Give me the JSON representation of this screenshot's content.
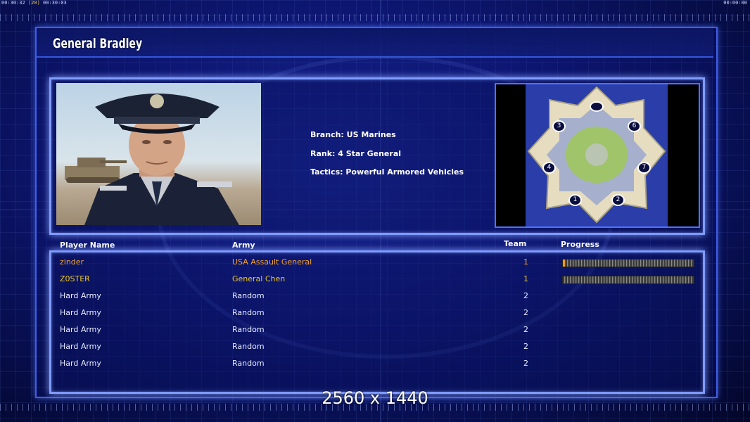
{
  "hud": {
    "time_left_prefix": "00:30:32",
    "time_left_mid": "(20)",
    "time_left_suffix": "00:30:03",
    "time_right": "00:00:00"
  },
  "general": {
    "name": "General Bradley",
    "branch": "Branch: US Marines",
    "rank": "Rank: 4 Star General",
    "tactics": "Tactics: Powerful Armored Vehicles"
  },
  "minimap": {
    "slots": [
      "1",
      "2",
      "3",
      "4",
      "6",
      "7"
    ]
  },
  "table": {
    "headers": {
      "name": "Player Name",
      "army": "Army",
      "team": "Team",
      "progress": "Progress"
    },
    "rows": [
      {
        "name": "zinder",
        "army": "USA Assault General",
        "team": "1",
        "progress": 0.01,
        "color": "#f2a129"
      },
      {
        "name": "Z0STER",
        "army": "General Chen",
        "team": "1",
        "progress": 0.0,
        "color": "#e9c626"
      },
      {
        "name": "Hard Army",
        "army": "Random",
        "team": "2",
        "color": "#e8ecff"
      },
      {
        "name": "Hard Army",
        "army": "Random",
        "team": "2",
        "color": "#e8ecff"
      },
      {
        "name": "Hard Army",
        "army": "Random",
        "team": "2",
        "color": "#e8ecff"
      },
      {
        "name": "Hard Army",
        "army": "Random",
        "team": "2",
        "color": "#e8ecff"
      },
      {
        "name": "Hard Army",
        "army": "Random",
        "team": "2",
        "color": "#e8ecff"
      }
    ]
  },
  "overlay": {
    "resolution": "2560 x 1440"
  }
}
